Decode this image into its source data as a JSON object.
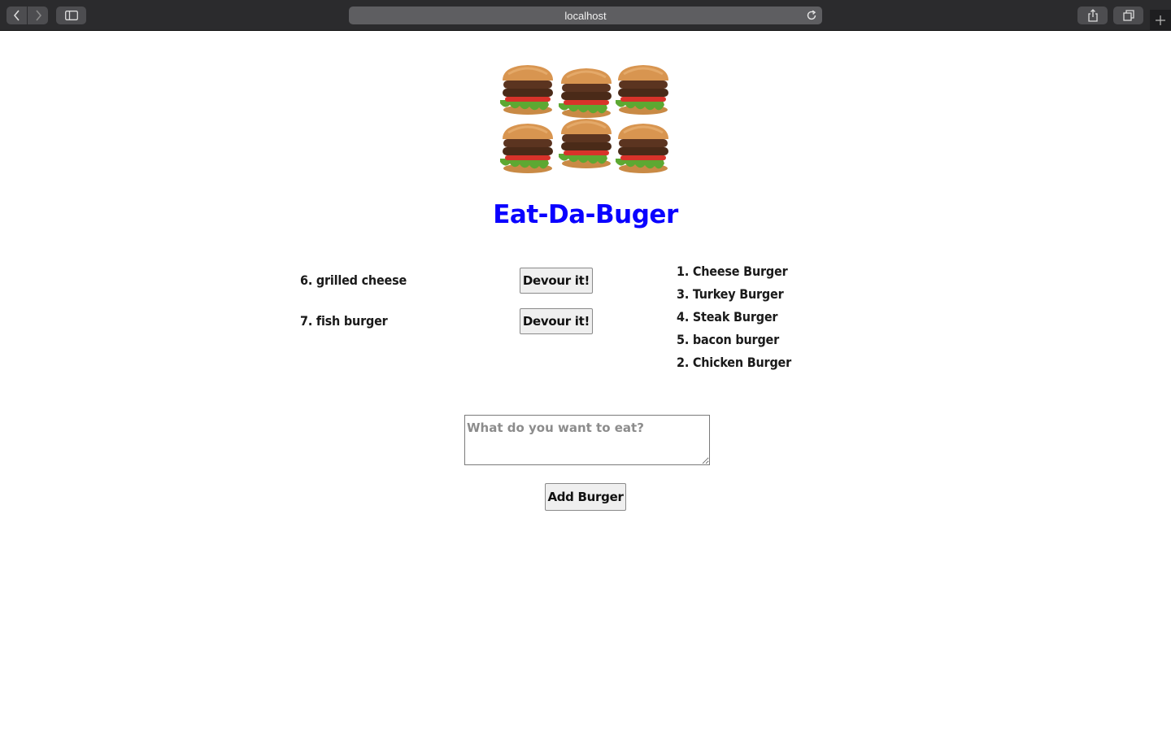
{
  "browser": {
    "url": "localhost",
    "icons": {
      "back": "chevron-left-icon",
      "forward": "chevron-right-icon",
      "sidebar": "sidebar-icon",
      "reload": "reload-icon",
      "share": "share-icon",
      "tabs": "tabs-overview-icon",
      "new_tab": "plus-icon"
    }
  },
  "page": {
    "title": "Eat-Da-Buger",
    "title_color": "#0a00ff",
    "hero_image": "burgers-image"
  },
  "burgers": {
    "not_devoured": [
      {
        "label": "6. grilled cheese",
        "button": "Devour it!"
      },
      {
        "label": "7. fish burger",
        "button": "Devour it!"
      }
    ],
    "devoured": [
      "1. Cheese Burger",
      "3. Turkey Burger",
      "4. Steak Burger",
      "5. bacon burger",
      "2. Chicken Burger"
    ]
  },
  "form": {
    "placeholder": "What do you want to eat?",
    "value": "",
    "submit_label": "Add Burger"
  }
}
